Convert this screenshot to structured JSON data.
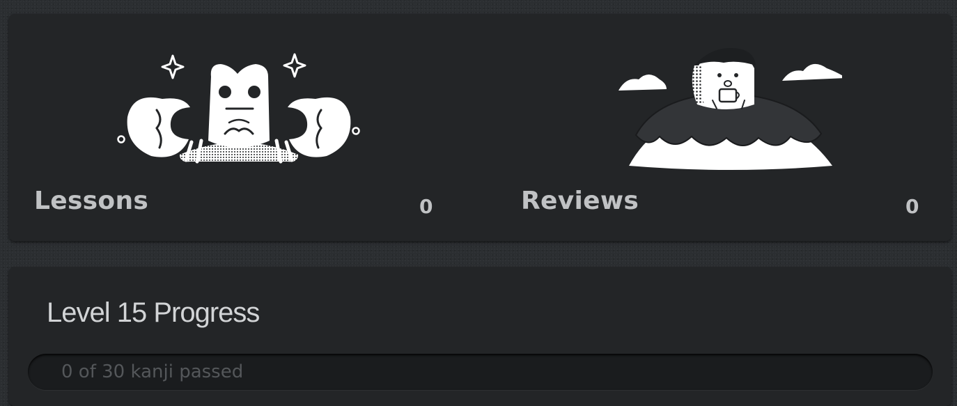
{
  "summary": {
    "lessons": {
      "title": "Lessons",
      "count": "0",
      "illustration": "crab-mascot-icon"
    },
    "reviews": {
      "title": "Reviews",
      "count": "0",
      "illustration": "turtle-on-island-icon"
    }
  },
  "progress": {
    "title": "Level 15 Progress",
    "label": "0 of 30 kanji passed",
    "passed": 0,
    "total": 30,
    "fraction": 0
  },
  "colors": {
    "page_background": "#2b2e31",
    "card_background": "#232527",
    "title_text": "#c0c2c4",
    "progress_track": "#1a1c1e",
    "progress_label": "#54575a"
  }
}
